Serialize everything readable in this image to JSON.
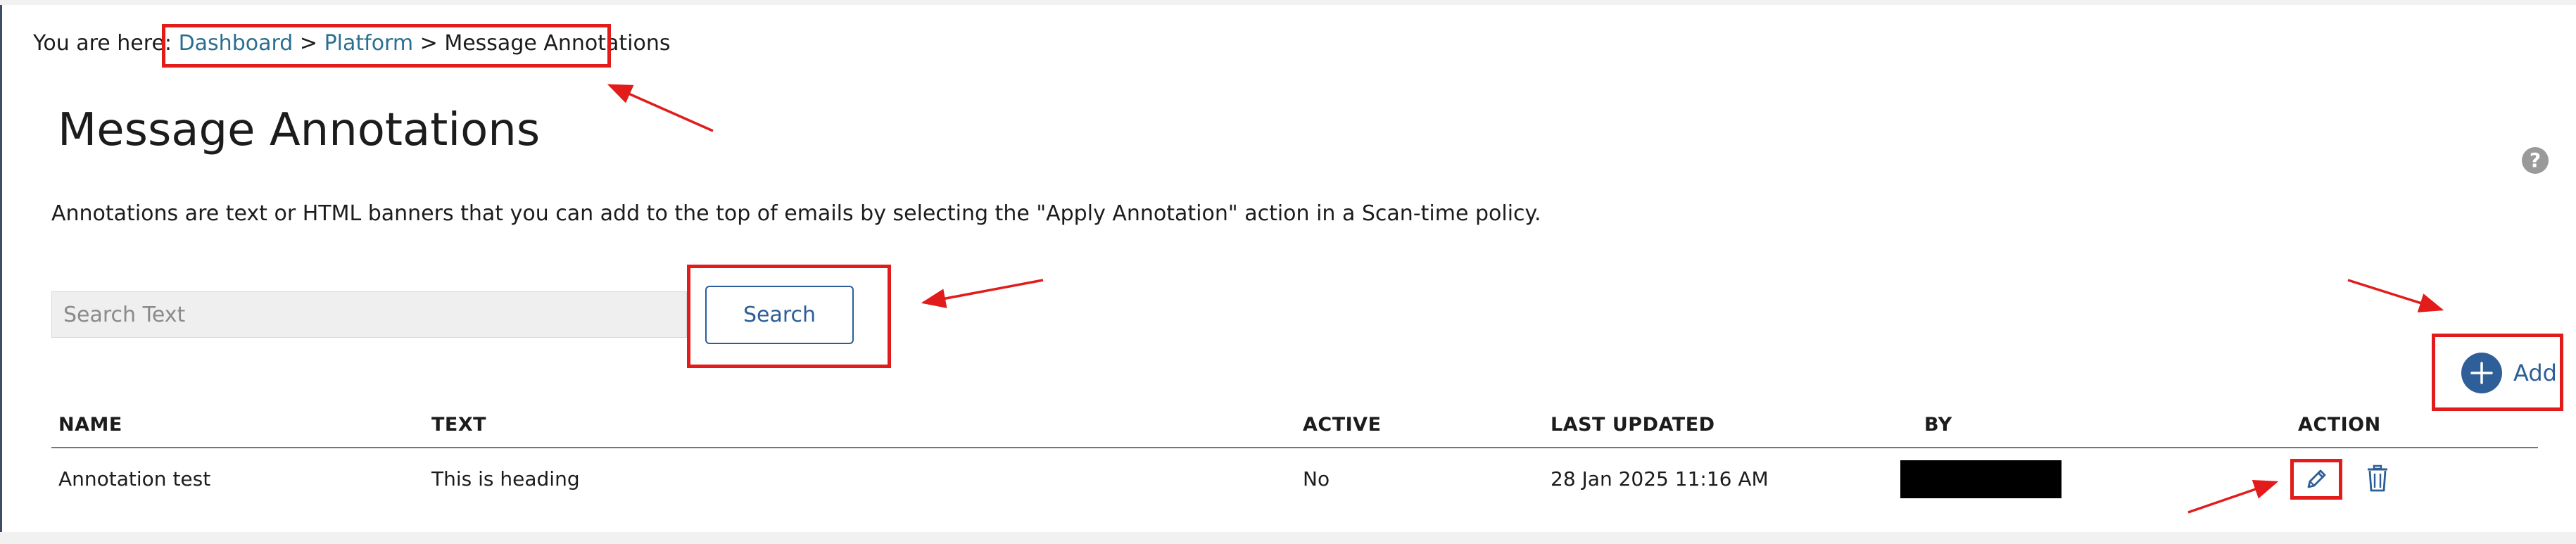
{
  "breadcrumb": {
    "prefix": "You are here:",
    "items": [
      "Dashboard",
      "Platform",
      "Message Annotations"
    ],
    "separator": ">"
  },
  "page": {
    "title": "Message Annotations",
    "description": "Annotations are text or HTML banners that you can add to the top of emails by selecting the \"Apply Annotation\" action in a Scan-time policy.",
    "help_icon": "?"
  },
  "search": {
    "placeholder": "Search Text",
    "value": "",
    "button_label": "Search"
  },
  "add_button": {
    "label": "Add",
    "icon": "plus-icon"
  },
  "table": {
    "columns": [
      "NAME",
      "TEXT",
      "ACTIVE",
      "LAST UPDATED",
      "BY",
      "ACTION"
    ],
    "rows": [
      {
        "name": "Annotation test",
        "text": "This is heading",
        "active": "No",
        "last_updated": "28 Jan 2025 11:16 AM",
        "by": "",
        "actions": [
          "pencil-icon",
          "trash-icon"
        ]
      }
    ]
  },
  "colors": {
    "accent": "#2c5e97",
    "link": "#2a6f91",
    "annotation_red": "#e21b1b",
    "redaction": "#000000"
  }
}
